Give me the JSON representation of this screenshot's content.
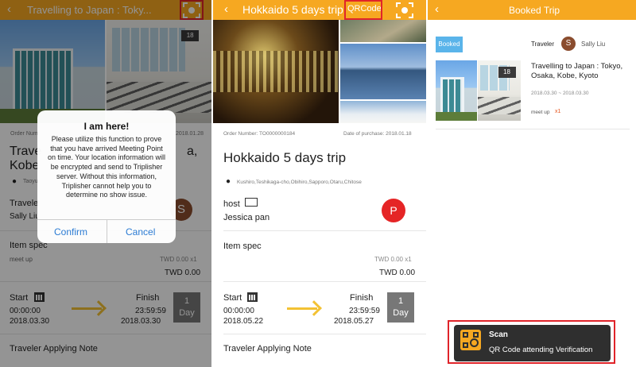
{
  "panel1": {
    "header_title": "Travelling to Japan : Toky...",
    "back_icon": "‹",
    "order_label": "Order Num",
    "order_date": "2018.01.28",
    "trip_title_line1": "Trave",
    "trip_title_suffix": "a,",
    "trip_title_line2": "Kobe",
    "location": "Taoyu",
    "traveler_label": "Travele",
    "traveler_name": "Sally Liu",
    "avatar_letter": "S",
    "item_spec_label": "Item spec",
    "meetup": "meet up",
    "price_row1": "TWD  0.00 x1",
    "price_total": "TWD  0.00",
    "start_label": "Start",
    "start_time": "00:00:00",
    "start_date": "2018.03.30",
    "finish_label": "Finish",
    "finish_time": "23:59:59",
    "finish_date": "2018.03.30",
    "days_value": "1",
    "days_label": "Day",
    "applying_note": "Traveler Applying Note",
    "dialog": {
      "title": "I am here!",
      "message": "Please utilize this function to prove that you have arrived Meeting Point on time. Your location information will be encrypted and send to Triplisher server. Without this information, Triplisher cannot help you to determine no show issue.",
      "confirm": "Confirm",
      "cancel": "Cancel"
    }
  },
  "panel2": {
    "header_title": "Hokkaido 5 days trip",
    "back_icon": "‹",
    "qrcode_button": "QRCode",
    "order_number": "Order Number: TO0000000184",
    "date_of_purchase": "Date of purchase: 2018.01.18",
    "trip_title": "Hokkaido 5 days trip",
    "location": "Kushiro,Teshikaga-cho,Obihiro,Sapporo,Otaru,Chitose",
    "host_label": "host",
    "host_name": "Jessica pan",
    "avatar_letter": "P",
    "item_spec_label": "Item spec",
    "price_row1": "TWD  0.00 x1",
    "price_total": "TWD  0.00",
    "start_label": "Start",
    "start_time": "00:00:00",
    "start_date": "2018.05.22",
    "finish_label": "Finish",
    "finish_time": "23:59:59",
    "finish_date": "2018.05.27",
    "days_value": "1",
    "days_label": "Day",
    "applying_note": "Traveler Applying Note"
  },
  "panel3": {
    "header_title": "Booked Trip",
    "back_icon": "‹",
    "booked_badge": "Booked",
    "traveler_label": "Traveler",
    "avatar_letter": "S",
    "traveler_name": "Sally Liu",
    "trip_title": "Travelling to Japan : Tokyo, Osaka, Kobe, Kyoto",
    "date_range": "2018.03.30 ~ 2018.03.30",
    "meetup": "meet up",
    "meetup_count": "x1",
    "toast": {
      "title": "Scan",
      "subtitle": "QR Code attending Verification"
    }
  },
  "colors": {
    "header": "#f6a821",
    "highlight": "#e0242a",
    "booked_badge": "#5ab4ea",
    "host_avatar": "#e52526",
    "arrow": "#f3c234",
    "link": "#2b7bd3"
  }
}
